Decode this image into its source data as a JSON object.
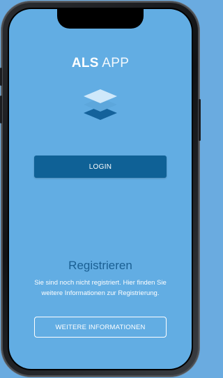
{
  "header": {
    "title_bold": "ALS",
    "title_light": "APP"
  },
  "logo": {
    "icon": "layers-icon",
    "colors": [
      "#cfe8fa",
      "#5da7dc",
      "#14629b"
    ]
  },
  "login": {
    "label": "LOGIN"
  },
  "register": {
    "heading": "Registrieren",
    "text": "Sie sind noch nicht registriert. Hier finden Sie weitere Informationen zur Registrierung.",
    "button_label": "WEITERE INFORMATIONEN"
  },
  "colors": {
    "background": "#62ade3",
    "primary_button": "#0f6196",
    "heading": "#1a5f93"
  }
}
